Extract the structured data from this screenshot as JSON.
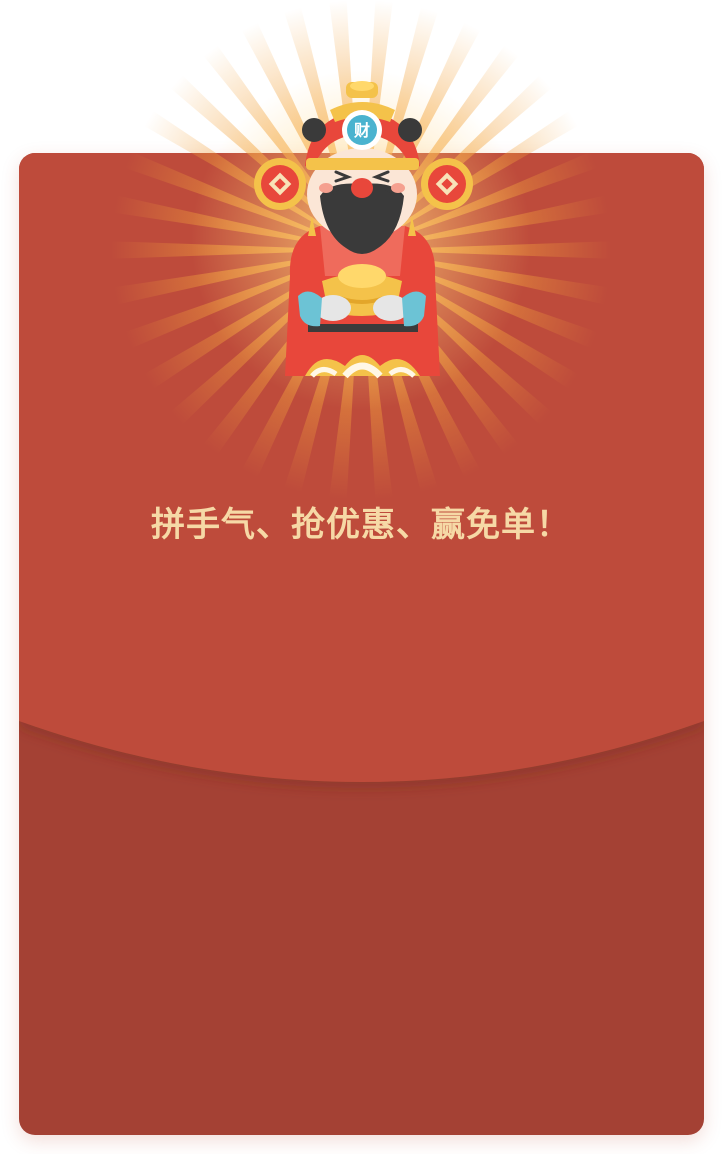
{
  "envelope": {
    "slogan": "拼手气、抢优惠、赢免单！",
    "colors": {
      "top_flap": "#be4c3a",
      "bottom_pocket": "#a44134",
      "slogan": "#f6d9a6",
      "rays": "#f2a23c"
    }
  },
  "mascot": {
    "name_icon": "god-of-wealth-icon",
    "hat_emblem": "财"
  }
}
